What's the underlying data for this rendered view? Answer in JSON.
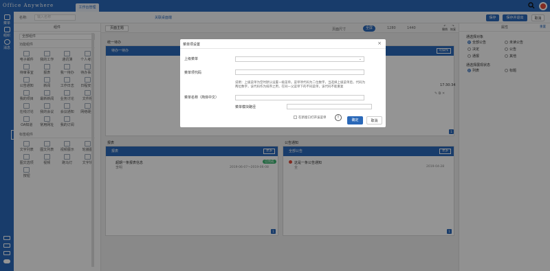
{
  "app": {
    "brand": "Office Anywhere",
    "tab": "工作台管理"
  },
  "nav": {
    "items": [
      "菜单",
      "组织",
      "消息"
    ]
  },
  "subbar": {
    "label": "名称:",
    "placeholder": "输入名称",
    "link": "关联桌面端",
    "save": "保存",
    "save_exit": "保存并退出",
    "cancel": "取消"
  },
  "palette": {
    "title": "组件",
    "select": "全部组件",
    "group1": "功能组件",
    "items1": [
      "电子邮件",
      "我的工作",
      "通讯薄",
      "个人考勤",
      "待审事宜",
      "报表",
      "我一待办",
      "待办事项",
      "公告通知",
      "新闻",
      "工作日志",
      "日程安排",
      "我的项目",
      "最新新闻",
      "业务讨论",
      "文件柜",
      "在线讨论",
      "我的会议",
      "会议通知",
      "网络硬盘",
      "OA知道",
      "常用网址",
      "我的订阅"
    ],
    "group2": "标签组件",
    "items2": [
      "文字列表",
      "图文列表",
      "视频展示",
      "轮播图",
      "图文选项",
      "视频",
      "跑马灯",
      "文字块",
      "按钮"
    ]
  },
  "canvas": {
    "theme_btn": "页面主题",
    "layout_label": "页面尺寸",
    "tabs": [
      "全屏",
      "1280",
      "1440"
    ],
    "undo": "撤销",
    "redo": "恢复",
    "panel1": {
      "caption": "统一待办",
      "title": "待办一待办",
      "btn": "可操作",
      "time": "17:30:34",
      "count": "1"
    },
    "panel2": {
      "caption": "报表",
      "title": "报表",
      "btn": "更多",
      "item_title": "超期一条报表信息",
      "item_sub": "李明",
      "status": "已完成",
      "date": "2019-06-07～2019-06-08",
      "count": "1"
    },
    "panel3": {
      "caption": "公告通知",
      "title": "全部公告",
      "btn": "更多",
      "item_title": "这是一条公告通知",
      "item_sub": "全",
      "date": "2019-04-28",
      "count": "1"
    }
  },
  "props": {
    "title": "属性",
    "reset": "重置",
    "sec1": "通选择对象",
    "opts1": [
      "全部公告",
      "未读公告",
      "决定",
      "公告",
      "通报",
      "其他"
    ],
    "sec2": "通选择展现状态",
    "opts2": [
      "列表",
      "标题"
    ]
  },
  "modal": {
    "title": "菜单项设置",
    "parent_label": "上级菜单",
    "code_label": "菜单项代码",
    "help": "说明：上级菜单为空时默认设置一级菜单。菜单项代码为二位数字，当选择上级菜单后，代码为两位数字，该代码作为排序之用，在同一父菜单下的不同菜单，该代码不能重复",
    "name_label": "菜单名称（简体中文）",
    "module_label": "菜单模块路径",
    "checkbox": "在新窗口打开该菜单",
    "ok": "确定",
    "cancel": "取消"
  }
}
